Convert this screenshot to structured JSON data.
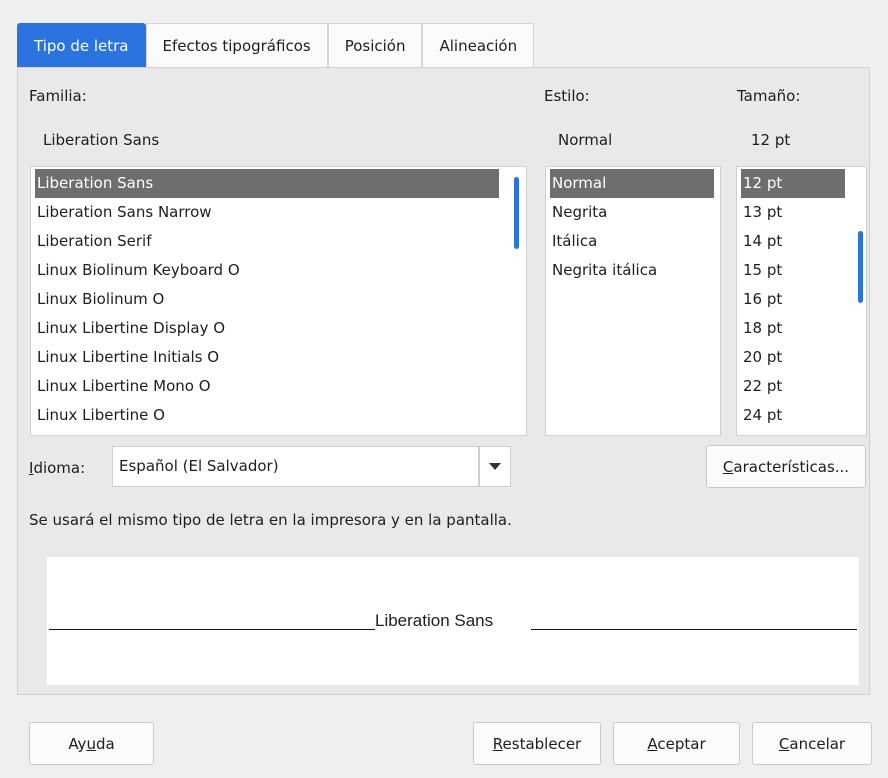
{
  "tabs": [
    {
      "label": "Tipo de letra",
      "active": true
    },
    {
      "label": "Efectos tipográficos",
      "active": false
    },
    {
      "label": "Posición",
      "active": false
    },
    {
      "label": "Alineación",
      "active": false
    }
  ],
  "family": {
    "label": "Familia:",
    "value": "Liberation Sans",
    "items": [
      "Liberation Sans",
      "Liberation Sans Narrow",
      "Liberation Serif",
      "Linux Biolinum Keyboard O",
      "Linux Biolinum O",
      "Linux Libertine Display O",
      "Linux Libertine Initials O",
      "Linux Libertine Mono O",
      "Linux Libertine O"
    ],
    "selected_index": 0
  },
  "style": {
    "label": "Estilo:",
    "value": "Normal",
    "items": [
      "Normal",
      "Negrita",
      "Itálica",
      "Negrita itálica"
    ],
    "selected_index": 0
  },
  "size": {
    "label": "Tamaño:",
    "value": "12 pt",
    "items": [
      "12 pt",
      "13 pt",
      "14 pt",
      "15 pt",
      "16 pt",
      "18 pt",
      "20 pt",
      "22 pt",
      "24 pt"
    ],
    "selected_index": 0
  },
  "language": {
    "label": "Idioma:",
    "value": "Español (El Salvador)"
  },
  "features_button": "Características...",
  "info_text": "Se usará el mismo tipo de letra en la impresora y en la pantalla.",
  "preview_text": "Liberation Sans",
  "buttons": {
    "help": "Ayuda",
    "reset": "Restablecer",
    "ok": "Aceptar",
    "cancel": "Cancelar"
  },
  "colors": {
    "accent": "#2b74e0",
    "selection": "#6e6e6e"
  }
}
